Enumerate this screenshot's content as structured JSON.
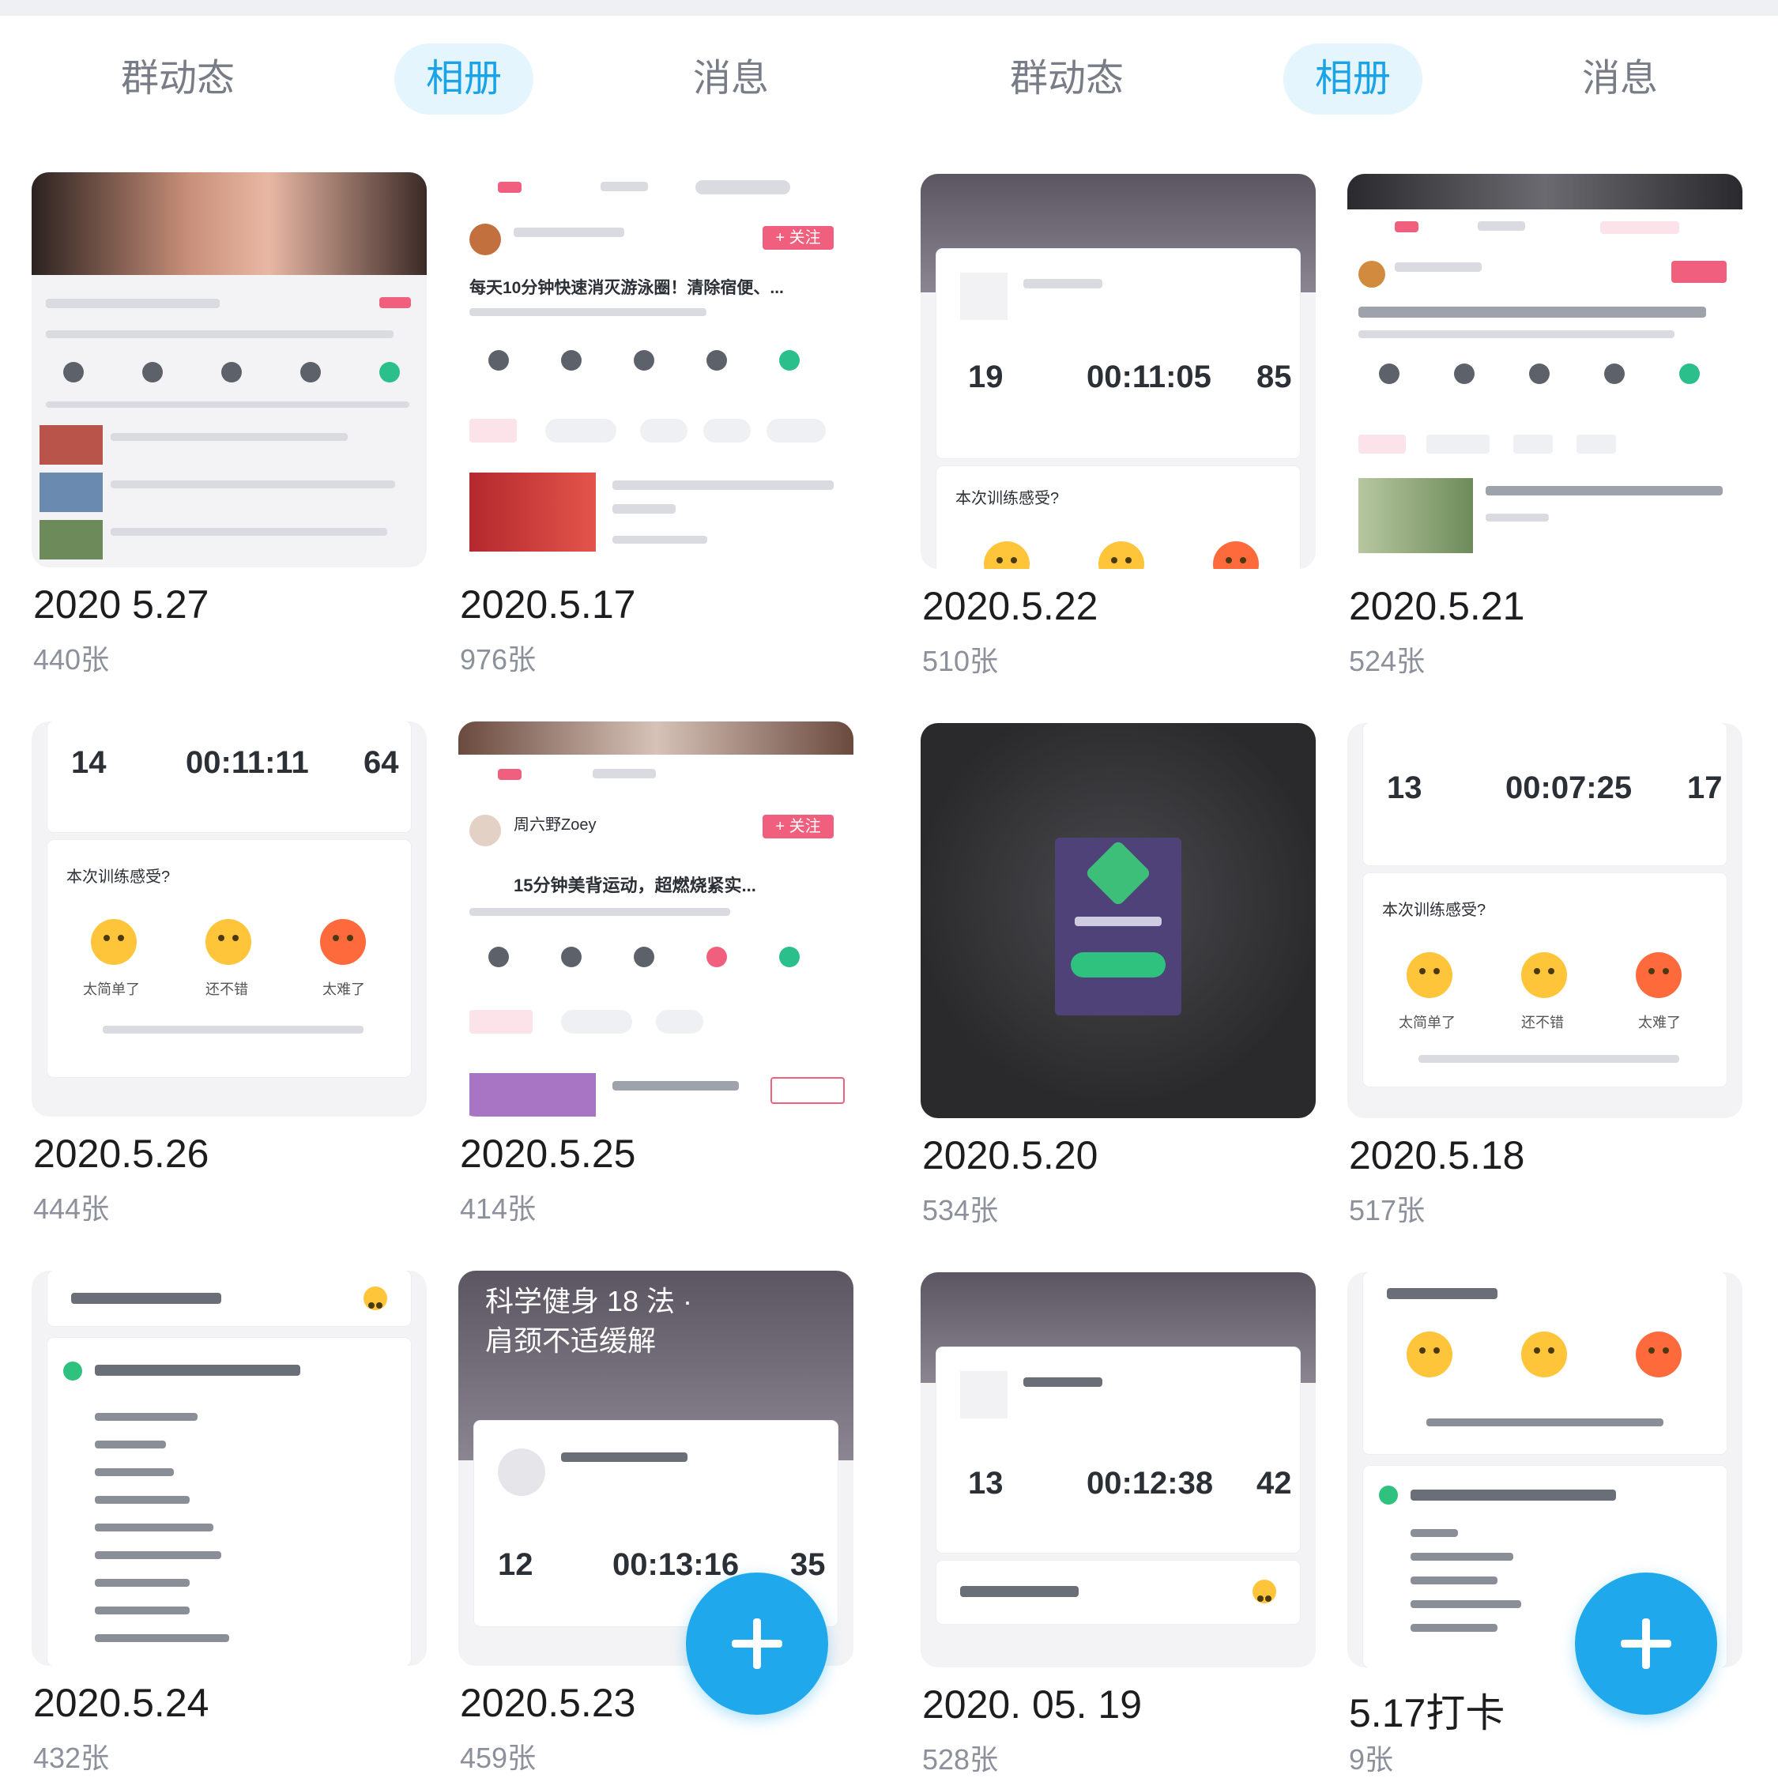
{
  "tabs_left": [
    {
      "label": "群动态",
      "active": false
    },
    {
      "label": "相册",
      "active": true
    },
    {
      "label": "消息",
      "active": false
    }
  ],
  "tabs_right": [
    {
      "label": "群动态",
      "active": false
    },
    {
      "label": "相册",
      "active": true
    },
    {
      "label": "消息",
      "active": false
    }
  ],
  "albums": [
    {
      "title": "2020 5.27",
      "count": "440张"
    },
    {
      "title": "2020.5.17",
      "count": "976张"
    },
    {
      "title": "2020.5.22",
      "count": "510张"
    },
    {
      "title": "2020.5.21",
      "count": "524张"
    },
    {
      "title": "2020.5.26",
      "count": "444张"
    },
    {
      "title": "2020.5.25",
      "count": "414张"
    },
    {
      "title": "2020.5.20",
      "count": "534张"
    },
    {
      "title": "2020.5.18",
      "count": "517张"
    },
    {
      "title": "2020.5.24",
      "count": "432张"
    },
    {
      "title": "2020.5.23",
      "count": "459张"
    },
    {
      "title": "2020. 05. 19",
      "count": "528张"
    },
    {
      "title": "5.17打卡",
      "count": "9张"
    }
  ],
  "thumbs": {
    "t2_headline": "每天10分钟快速消灭游泳圈！清除宿便、...",
    "t2_follow": "+ 关注",
    "t3": {
      "s1": "19",
      "time": "00:11:05",
      "s3": "85",
      "q": "本次训练感受?"
    },
    "t5": {
      "s1": "14",
      "time": "00:11:11",
      "s3": "64",
      "q": "本次训练感受?",
      "e1": "太简单了",
      "e2": "还不错",
      "e3": "太难了"
    },
    "t6_user": "周六野Zoey",
    "t6_headline": "15分钟美背运动，超燃烧紧实...",
    "t6_follow": "+ 关注",
    "t8": {
      "s1": "13",
      "time": "00:07:25",
      "s3": "17",
      "q": "本次训练感受?",
      "e1": "太简单了",
      "e2": "还不错",
      "e3": "太难了"
    },
    "t10": {
      "head1": "科学健身 18 法 ·",
      "head2": "肩颈不适缓解",
      "s1": "12",
      "time": "00:13:16",
      "s3": "35"
    },
    "t11": {
      "s1": "13",
      "time": "00:12:38",
      "s3": "42"
    }
  },
  "colors": {
    "accent": "#1aa3e6",
    "fab": "#1fa8ec",
    "pink": "#f0607e"
  },
  "fab_icon": "plus-icon"
}
